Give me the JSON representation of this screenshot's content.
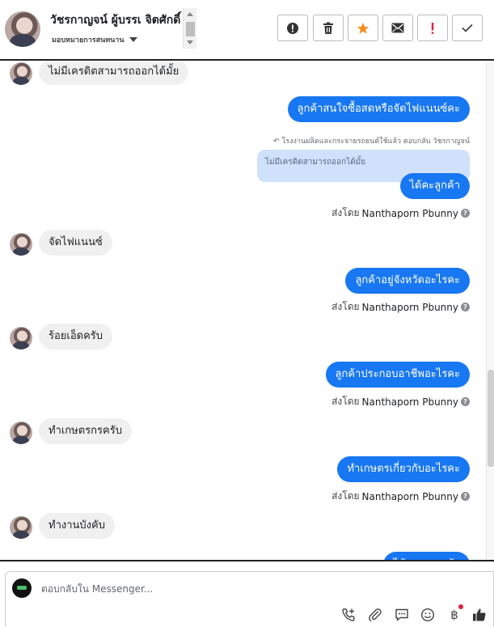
{
  "colors": {
    "accent": "#1877f2",
    "star": "#f58c1f",
    "danger": "#e41e3f"
  },
  "header": {
    "contact_name": "วัชรกาญจน์ ผู้บรรเ จิตศักดิ์",
    "assignment_label": "มอบหมายการสนทนาน",
    "toolbar_icons": [
      "alert-circle-icon",
      "trash-icon",
      "star-icon",
      "mail-icon",
      "exclamation-icon",
      "check-icon"
    ]
  },
  "thread": {
    "messages": [
      {
        "kind": "in",
        "text": "ไม่มีเครดิตสามารถออกได้มั้ย"
      },
      {
        "kind": "out",
        "text": "ลูกค้าสนใจซื้อสดหรือจัดไฟแนนซ์คะ"
      },
      {
        "kind": "reply_meta",
        "text": "โรงงานผลิตและกระจายรถยนต์ใช้แล้ว ตอบกลับ วัชรกาญจน์"
      },
      {
        "kind": "quoted",
        "text": "ไม่มีเครดิตสามารถออกได้มั้ย"
      },
      {
        "kind": "out",
        "text": "ได้คะลูกค้า"
      },
      {
        "kind": "sent_by",
        "prefix": "ส่งโดย",
        "who": "Nanthaporn Pbunny"
      },
      {
        "kind": "in",
        "text": "จัดไฟแนนซ์"
      },
      {
        "kind": "out",
        "text": "ลูกค้าอยู่จังหวัดอะไรคะ"
      },
      {
        "kind": "sent_by",
        "prefix": "ส่งโดย",
        "who": "Nanthaporn Pbunny"
      },
      {
        "kind": "in",
        "text": "ร้อยเอ็ดครับ"
      },
      {
        "kind": "out",
        "text": "ลูกค้าประกอบอาชีพอะไรคะ"
      },
      {
        "kind": "sent_by",
        "prefix": "ส่งโดย",
        "who": "Nanthaporn Pbunny"
      },
      {
        "kind": "in",
        "text": "ทำเกษตรกรครับ"
      },
      {
        "kind": "out",
        "text": "ทำเกษตรเกี่ยวกับอะไรคะ"
      },
      {
        "kind": "sent_by",
        "prefix": "ส่งโดย",
        "who": "Nanthaporn Pbunny"
      },
      {
        "kind": "in",
        "text": "ทำงานบังคับ"
      },
      {
        "kind": "out",
        "text": "ไม้ยางพาราค้า"
      }
    ]
  },
  "composer": {
    "placeholder": "ตอบกลับใน Messenger...",
    "icons": [
      "phone-plus-icon",
      "attachment-icon",
      "saved-reply-icon",
      "emoji-icon",
      "baht-icon",
      "like-icon"
    ],
    "baht_glyph": "฿"
  }
}
